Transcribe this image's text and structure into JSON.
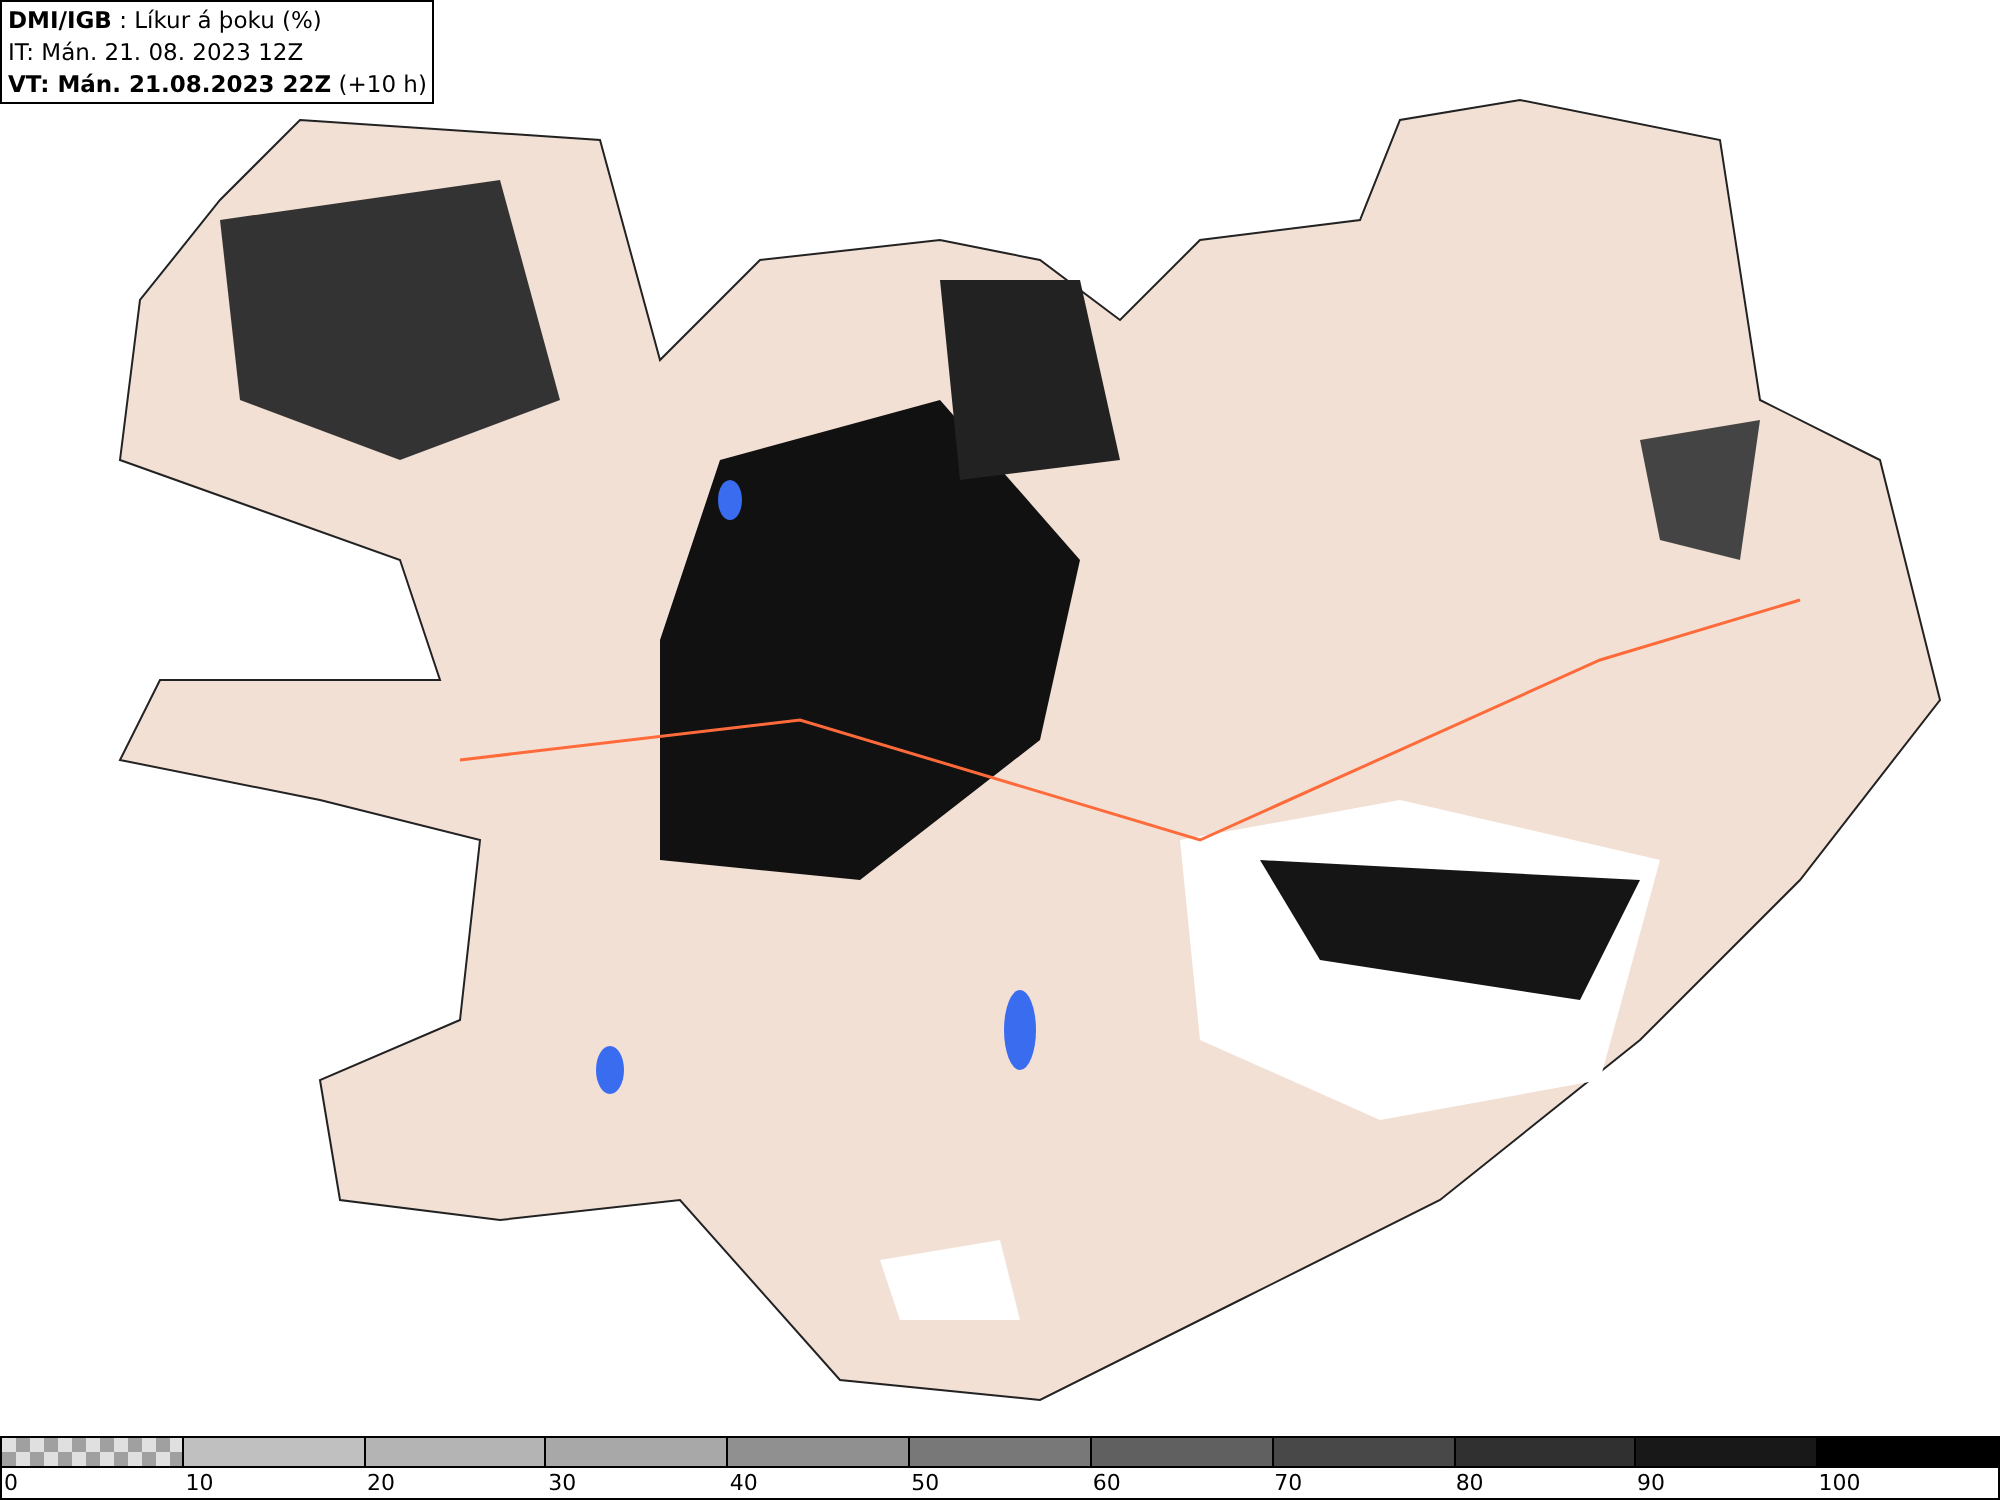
{
  "header": {
    "lines": [
      "**DMI/IGB** : Líkur á þoku (%)",
      "IT: Mán. 21. 08. 2023 12Z",
      "**VT: Mán. 21.08.2023 22Z** (+10 h)"
    ]
  },
  "legend": {
    "segments": [
      {
        "kind": "checker",
        "color": "#a0a0a0"
      },
      {
        "kind": "solid",
        "color": "#c0c0c0"
      },
      {
        "kind": "solid",
        "color": "#b4b4b4"
      },
      {
        "kind": "solid",
        "color": "#a8a8a8"
      },
      {
        "kind": "solid",
        "color": "#909090"
      },
      {
        "kind": "solid",
        "color": "#787878"
      },
      {
        "kind": "solid",
        "color": "#606060"
      },
      {
        "kind": "solid",
        "color": "#484848"
      },
      {
        "kind": "solid",
        "color": "#303030"
      },
      {
        "kind": "solid",
        "color": "#181818"
      },
      {
        "kind": "solid",
        "color": "#000000"
      }
    ],
    "labels": [
      "0",
      "10",
      "20",
      "30",
      "40",
      "50",
      "60",
      "70",
      "80",
      "90",
      "100"
    ]
  }
}
